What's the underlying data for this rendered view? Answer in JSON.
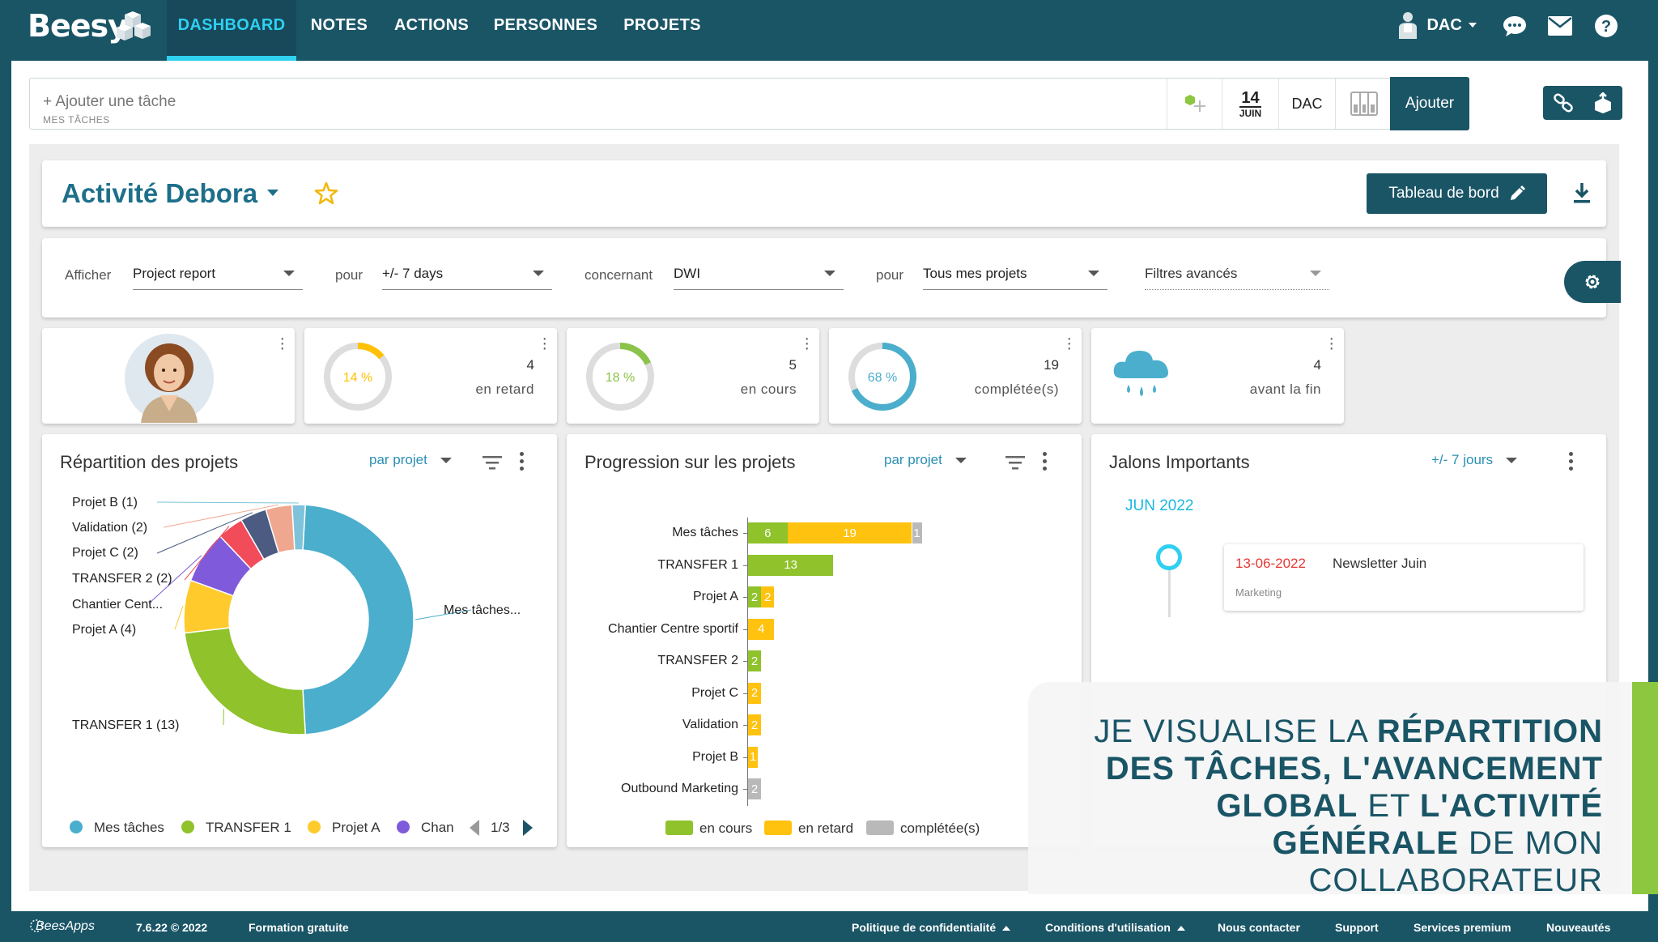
{
  "app": {
    "logo": "Beesy",
    "nav": [
      "DASHBOARD",
      "NOTES",
      "ACTIONS",
      "PERSONNES",
      "PROJETS"
    ],
    "active_nav": "DASHBOARD",
    "user": "DAC"
  },
  "taskbar": {
    "placeholder": "+ Ajouter une tâche",
    "sub": "MES TÂCHES",
    "date_day": "14",
    "date_month": "JUIN",
    "owner": "DAC",
    "add_label": "Ajouter"
  },
  "header": {
    "title": "Activité Debora",
    "board_button": "Tableau de bord"
  },
  "filters": {
    "afficher_label": "Afficher",
    "afficher_value": "Project report",
    "pour_label": "pour",
    "period_value": "+/- 7 days",
    "concernant_label": "concernant",
    "concernant_value": "DWI",
    "pour2_label": "pour",
    "projects_value": "Tous mes projets",
    "advanced": "Filtres avancés"
  },
  "kpis": [
    {
      "pct": "14 %",
      "pct_value": 14,
      "value": "4",
      "label": "en retard",
      "color": "#ffc107"
    },
    {
      "pct": "18 %",
      "pct_value": 18,
      "value": "5",
      "label": "en cours",
      "color": "#8bc34a"
    },
    {
      "pct": "68 %",
      "pct_value": 68,
      "value": "19",
      "label": "complétée(s)",
      "color": "#4aaecc"
    },
    {
      "value": "4",
      "label": "avant la fin"
    }
  ],
  "repartition": {
    "title": "Répartition des projets",
    "selector": "par projet",
    "labels": [
      "Projet B (1)",
      "Validation (2)",
      "Projet C (2)",
      "TRANSFER 2 (2)",
      "Chantier Cent...",
      "Projet A (4)",
      "TRANSFER 1 (13)",
      "Mes tâches..."
    ],
    "legend": [
      "Mes tâches",
      "TRANSFER 1",
      "Projet A",
      "Chan"
    ],
    "pager": "1/3"
  },
  "progression": {
    "title": "Progression sur les projets",
    "selector": "par projet",
    "legend": [
      "en cours",
      "en retard",
      "complétée(s)"
    ]
  },
  "jalons": {
    "title": "Jalons Importants",
    "selector": "+/- 7 jours",
    "month": "JUN 2022",
    "event_date": "13-06-2022",
    "event_title": "Newsletter Juin",
    "event_tag": "Marketing"
  },
  "overlay": {
    "line1_a": "JE VISUALISE LA ",
    "line1_b": "RÉPARTITION DES TÂCHES, L'AVANCEMENT GLOBAL",
    "line2_a": " ET ",
    "line2_b": "L'ACTIVITÉ GÉNÉRALE",
    "line2_c": " DE MON COLLABORATEUR"
  },
  "footer": {
    "brand": "BeesApps",
    "version": "7.6.22 © 2022",
    "formation": "Formation gratuite",
    "privacy": "Politique de confidentialité",
    "terms": "Conditions d'utilisation",
    "contact": "Nous contacter",
    "support": "Support",
    "premium": "Services premium",
    "news": "Nouveautés"
  },
  "chart_data": [
    {
      "type": "pie",
      "title": "Répartition des projets",
      "categories": [
        "Mes tâches",
        "TRANSFER 1",
        "Projet A",
        "Chantier Centre sportif",
        "TRANSFER 2",
        "Projet C",
        "Validation",
        "Projet B"
      ],
      "values": [
        26,
        13,
        4,
        4,
        2,
        2,
        2,
        1
      ],
      "colors": [
        "#4aaecc",
        "#8fc22b",
        "#ffca2c",
        "#7f5bdb",
        "#f24b5a",
        "#4c5b82",
        "#efa78f",
        "#7ec3da"
      ]
    },
    {
      "type": "bar",
      "title": "Progression sur les projets",
      "orientation": "horizontal",
      "stacked": true,
      "categories": [
        "Mes tâches",
        "TRANSFER 1",
        "Projet A",
        "Chantier Centre sportif",
        "TRANSFER 2",
        "Projet C",
        "Validation",
        "Projet B",
        "Outbound Marketing"
      ],
      "series": [
        {
          "name": "en cours",
          "color": "#8fc22b",
          "values": [
            6,
            13,
            2,
            0,
            2,
            0,
            0,
            0,
            0
          ]
        },
        {
          "name": "en retard",
          "color": "#ffc20e",
          "values": [
            19,
            0,
            2,
            4,
            0,
            2,
            2,
            1,
            0
          ]
        },
        {
          "name": "complétée(s)",
          "color": "#b9b9b9",
          "values": [
            1,
            0,
            0,
            0,
            0,
            0,
            0,
            0,
            2
          ]
        }
      ]
    }
  ]
}
